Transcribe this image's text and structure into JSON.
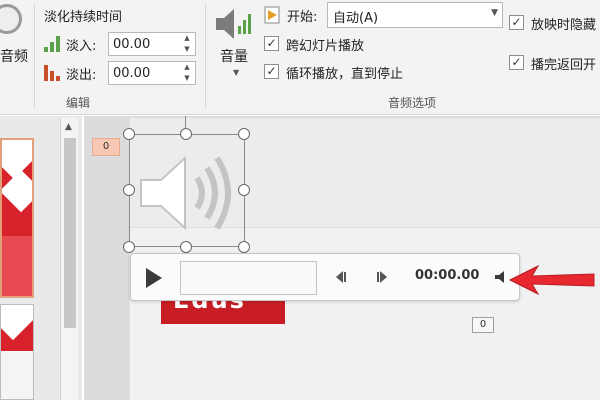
{
  "ribbon": {
    "audio_button_label": "音频",
    "editing_group": {
      "label": "编辑",
      "fade_duration_title": "淡化持续时间",
      "fade_in_label": "淡入:",
      "fade_in_value": "00.00",
      "fade_out_label": "淡出:",
      "fade_out_value": "00.00"
    },
    "volume_label": "音量",
    "audio_options_group": {
      "label": "音频选项",
      "start_label": "开始:",
      "start_value": "自动(A)",
      "play_across_slides": "跨幻灯片播放",
      "loop_until_stopped": "循环播放，直到停止",
      "hide_during_show": "放映时隐藏",
      "rewind_after_playing": "播完返回开"
    }
  },
  "slide": {
    "animation_tag_1": "0",
    "animation_tag_2": "0",
    "red_box_text": "Edus"
  },
  "player": {
    "time": "00:00.00"
  },
  "colors": {
    "accent_red": "#d8222b",
    "arrow_red": "#e8282f",
    "fade_in_green": "#5aa14a",
    "fade_out_orange": "#c8502a"
  }
}
